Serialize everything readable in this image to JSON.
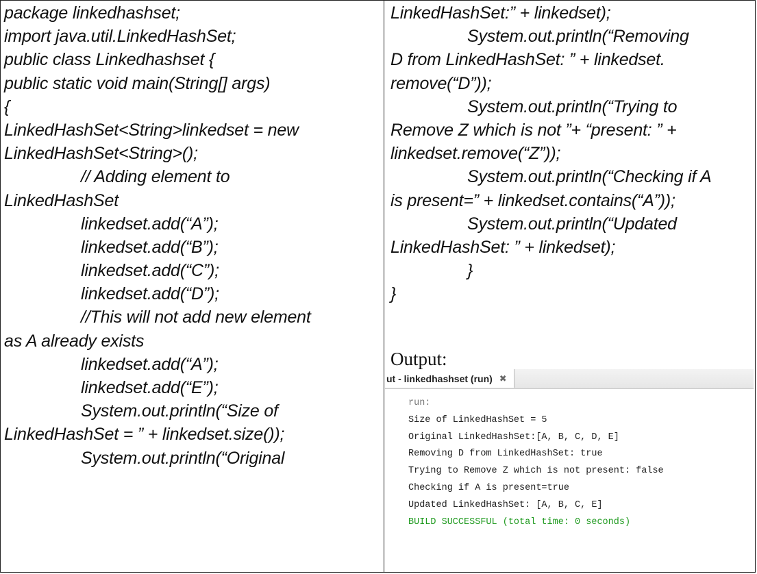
{
  "left_code": [
    {
      "text": "package linkedhashset;",
      "indent": false
    },
    {
      "text": "import java.util.LinkedHashSet;",
      "indent": false
    },
    {
      "text": "public class Linkedhashset {",
      "indent": false
    },
    {
      "text": "public static void main(String[] args)",
      "indent": false
    },
    {
      "text": "{",
      "indent": false
    },
    {
      "text": "LinkedHashSet<String>linkedset = new",
      "indent": false
    },
    {
      "text": "LinkedHashSet<String>();",
      "indent": false
    },
    {
      "text": "// Adding element to",
      "indent": true
    },
    {
      "text": "LinkedHashSet",
      "indent": false
    },
    {
      "text": "linkedset.add(“A”);",
      "indent": true
    },
    {
      "text": "linkedset.add(“B”);",
      "indent": true
    },
    {
      "text": "linkedset.add(“C”);",
      "indent": true
    },
    {
      "text": "linkedset.add(“D”);",
      "indent": true
    },
    {
      "text": "//This will not add new element",
      "indent": true
    },
    {
      "text": "as A already exists",
      "indent": false
    },
    {
      "text": "linkedset.add(“A”);",
      "indent": true
    },
    {
      "text": "linkedset.add(“E”);",
      "indent": true
    },
    {
      "text": "System.out.println(“Size of",
      "indent": true
    },
    {
      "text": "LinkedHashSet = ” + linkedset.size());",
      "indent": false
    },
    {
      "text": "System.out.println(“Original",
      "indent": true
    }
  ],
  "right_code": [
    {
      "text": "LinkedHashSet:” + linkedset);",
      "indent": false
    },
    {
      "text": "System.out.println(“Removing",
      "indent": true
    },
    {
      "text": "D from LinkedHashSet: ” + linkedset.",
      "indent": false
    },
    {
      "text": "remove(“D”));",
      "indent": false
    },
    {
      "text": "System.out.println(“Trying to",
      "indent": true
    },
    {
      "text": "Remove Z which is not ”+ “present: ” +",
      "indent": false
    },
    {
      "text": "linkedset.remove(“Z”));",
      "indent": false
    },
    {
      "text": "System.out.println(“Checking if A",
      "indent": true
    },
    {
      "text": "is present=” + linkedset.contains(“A”));",
      "indent": false
    },
    {
      "text": "System.out.println(“Updated",
      "indent": true
    },
    {
      "text": "LinkedHashSet: ” + linkedset);",
      "indent": false
    },
    {
      "text": "}",
      "indent": true
    },
    {
      "text": "}",
      "indent": false
    }
  ],
  "output_label": "Output:",
  "console": {
    "tab_title": "ut - linkedhashset (run)",
    "tab_close_glyph": "✖",
    "lines": [
      {
        "text": "run:",
        "kind": "run"
      },
      {
        "text": "Size of LinkedHashSet = 5",
        "kind": "normal"
      },
      {
        "text": "Original LinkedHashSet:[A, B, C, D, E]",
        "kind": "normal"
      },
      {
        "text": "Removing D from LinkedHashSet: true",
        "kind": "normal"
      },
      {
        "text": "Trying to Remove Z which is not present: false",
        "kind": "normal"
      },
      {
        "text": "Checking if A is present=true",
        "kind": "normal"
      },
      {
        "text": "Updated LinkedHashSet: [A, B, C, E]",
        "kind": "normal"
      },
      {
        "text": "BUILD SUCCESSFUL (total time: 0 seconds)",
        "kind": "success"
      }
    ]
  }
}
